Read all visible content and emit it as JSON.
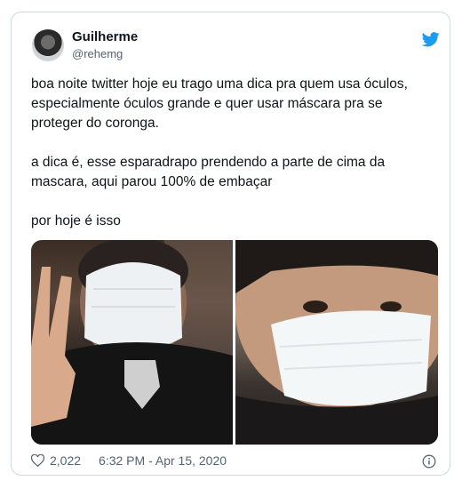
{
  "tweet": {
    "author_name": "Guilherme",
    "author_handle": "@rehemg",
    "paragraphs": [
      "boa noite twitter hoje eu trago uma dica pra quem usa óculos, especialmente óculos grande e quer usar máscara pra se proteger do coronga.",
      "a dica é, esse esparadrapo prendendo a parte de cima da mascara, aqui parou 100% de embaçar",
      "por hoje é isso"
    ],
    "likes": "2,022",
    "timestamp": "6:32 PM - Apr 15, 2020"
  },
  "icons": {
    "brand": "twitter-bird-icon",
    "like": "heart-icon",
    "info": "info-icon"
  },
  "colors": {
    "brand_blue": "#1d9bf0",
    "text": "#0f1419",
    "muted": "#536471",
    "border": "#cfd9de"
  }
}
